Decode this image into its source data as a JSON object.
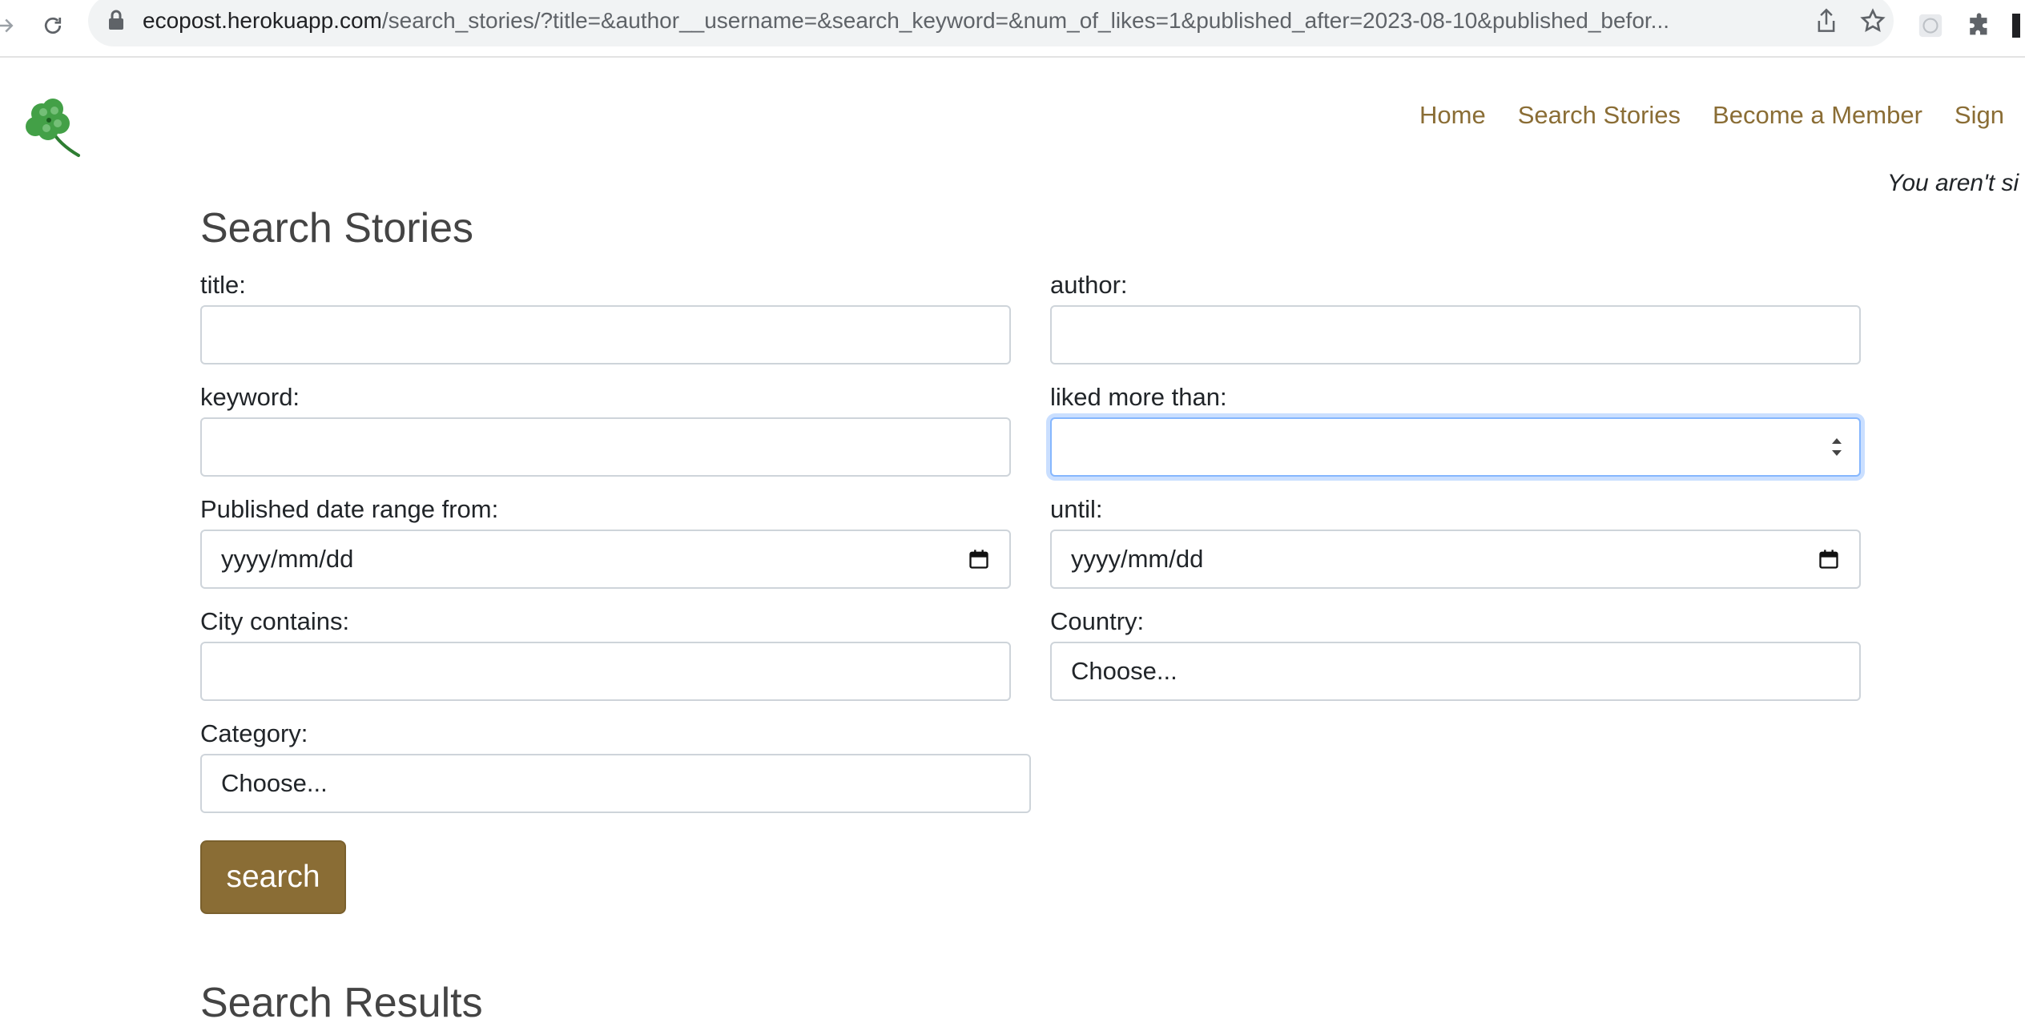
{
  "browser": {
    "url_host": "ecopost.herokuapp.com",
    "url_path": "/search_stories/?title=&author__username=&search_keyword=&num_of_likes=1&published_after=2023-08-10&published_befor..."
  },
  "nav": {
    "items": [
      "Home",
      "Search Stories",
      "Become a Member",
      "Sign"
    ]
  },
  "notice": "You aren't si",
  "form": {
    "title": "Search Stories",
    "title_label": "title:",
    "title_value": "",
    "author_label": "author:",
    "author_value": "",
    "keyword_label": "keyword:",
    "keyword_value": "",
    "likes_label": "liked more than:",
    "likes_value": "",
    "from_label": "Published date range from:",
    "from_value": "yyyy/mm/dd",
    "until_label": "until:",
    "until_value": "yyyy/mm/dd",
    "city_label": "City contains:",
    "city_value": "",
    "country_label": "Country:",
    "country_value": "Choose...",
    "category_label": "Category:",
    "category_value": "Choose...",
    "search_button": "search"
  },
  "results": {
    "title": "Search Results"
  },
  "colors": {
    "brand": "#8a6d35",
    "focus_ring": "#86b7fe"
  }
}
